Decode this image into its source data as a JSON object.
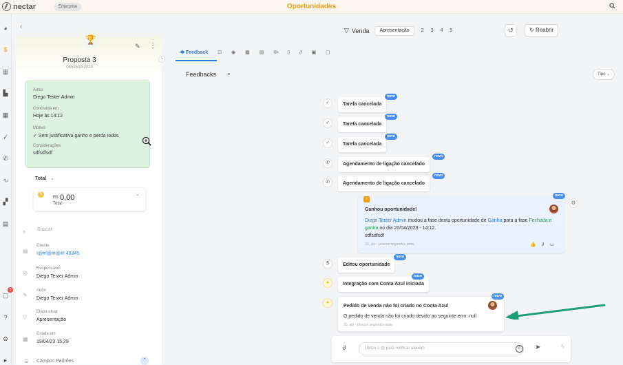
{
  "topbar": {
    "logo": "nectar",
    "plan": "Enterprise",
    "title": "Oportunidades"
  },
  "rail": {
    "notification_count": "9"
  },
  "proposal": {
    "name": "Proposta 3",
    "code": "0459509/2023",
    "summary": [
      {
        "label": "Autor",
        "value": "Diego Tester Admin"
      },
      {
        "label": "Concluída em",
        "value": "Hoje às 14:12"
      },
      {
        "label": "Motivo",
        "value": "✓ Sem justificativa ganho e perda todos"
      },
      {
        "label": "Considerações",
        "value": "sdfsdfsdf"
      }
    ],
    "total_label": "Total",
    "currency": "R$",
    "amount": "0,00",
    "amount_caption": "Total",
    "search_placeholder": "Buscar",
    "fields": [
      {
        "label": "Cliente",
        "value": "I@#!@#I@#! 45345"
      },
      {
        "label": "Responsável",
        "value": "Diego Tester Admin"
      },
      {
        "label": "Autor",
        "value": "Diego Tester Admin"
      },
      {
        "label": "Etapa atual",
        "value": "Apresentação"
      },
      {
        "label": "Criada em",
        "value": "19/04/23 15:29"
      }
    ],
    "campos": "Campos Padrões"
  },
  "pipeline": {
    "label": "Venda",
    "current": "Apresentação",
    "steps": [
      "2",
      "3",
      "4",
      "5"
    ],
    "reopen": "Reabrir"
  },
  "tabs": {
    "feedback": "Feedback"
  },
  "feed": {
    "title": "Feedbacks",
    "filter": "Tipo",
    "new_badge": "novo",
    "events": [
      "Tarefa cancelada",
      "Tarefa cancelada",
      "Tarefa cancelada",
      "Agendamento de ligação cancelado",
      "Agendamento de ligação cancelado",
      "Editou oportunidade",
      "Integração com Conta Azul iniciada"
    ],
    "won": {
      "title": "Ganhou oportunidade!",
      "user": "Diego Tester Admin",
      "t1": " mudou a fase desta oportunidade de ",
      "stage": "Ganha",
      "t2": " para a fase ",
      "new_stage": "Fechada e ganha",
      "t3": " no dia 20/04/2023 - 14:12.",
      "note": "sdfsdfsdf",
      "meta": "20, abr - poucos segundos atrás"
    },
    "error": {
      "title": "Pedido de venda não foi criado no Conta Azul",
      "text": "O pedido de venda não foi criado devido ao seguinte erro: null",
      "meta": "20, abr - poucos segundos atrás"
    }
  },
  "composer": {
    "placeholder": "Utilize o @ para notificar alguém"
  },
  "colors": {
    "accent": "#f39c12",
    "link": "#2f7fd6",
    "success_card": "#dcf3e0",
    "badge": "#4a8df0",
    "arrow": "#1e9e78"
  }
}
